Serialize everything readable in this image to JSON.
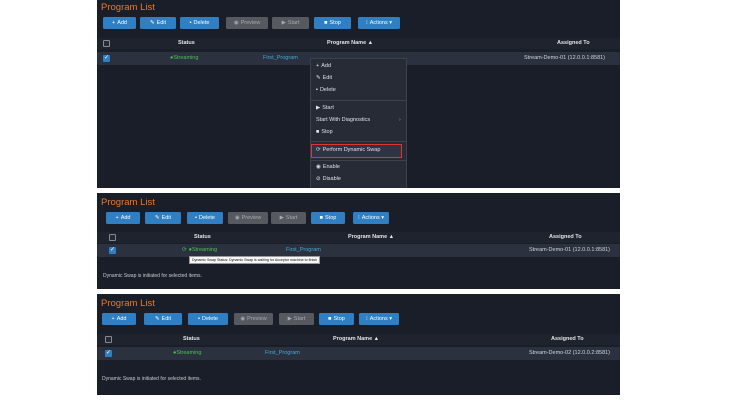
{
  "panels": [
    {
      "title": "Program List",
      "toolbar": {
        "add": "Add",
        "edit": "Edit",
        "delete": "Delete",
        "preview": "Preview",
        "start": "Start",
        "stop": "Stop",
        "actions": "Actions"
      },
      "headers": {
        "status": "Status",
        "program_name": "Program Name",
        "assigned_to": "Assigned To"
      },
      "row": {
        "status": "Streaming",
        "program_name": "First_Program",
        "assigned_to": "Stream-Demo-01 (12.0.0.1:8581)"
      },
      "menu": {
        "add": "Add",
        "edit": "Edit",
        "delete": "Delete",
        "start": "Start",
        "start_diag": "Start With Diagnostics",
        "stop": "Stop",
        "dynamic_swap": "Perform Dynamic Swap",
        "enable": "Enable",
        "disable": "Disable"
      }
    },
    {
      "title": "Program List",
      "toolbar": {
        "add": "Add",
        "edit": "Edit",
        "delete": "Delete",
        "preview": "Preview",
        "start": "Start",
        "stop": "Stop",
        "actions": "Actions"
      },
      "headers": {
        "status": "Status",
        "program_name": "Program Name",
        "assigned_to": "Assigned To"
      },
      "row": {
        "status": "Streaming",
        "program_name": "First_Program",
        "assigned_to": "Stream-Demo-01 (12.0.0.1:8581)"
      },
      "tooltip": "Dynamic Swap Status: Dynamic Swap is waiting for Acceptor machine to finish",
      "message": "Dynamic Swap is initiated for selected items."
    },
    {
      "title": "Program List",
      "toolbar": {
        "add": "Add",
        "edit": "Edit",
        "delete": "Delete",
        "preview": "Preview",
        "start": "Start",
        "stop": "Stop",
        "actions": "Actions"
      },
      "headers": {
        "status": "Status",
        "program_name": "Program Name",
        "assigned_to": "Assigned To"
      },
      "row": {
        "status": "Streaming",
        "program_name": "First_Program",
        "assigned_to": "Stream-Demo-02 (12.0.0.2:8581)"
      },
      "message": "Dynamic Swap is initiated for selected items."
    }
  ],
  "icons": {
    "add": "plus-icon",
    "edit": "edit-icon",
    "delete": "trash-icon",
    "preview": "eye-icon",
    "start": "play-icon",
    "stop": "stop-icon",
    "actions": "menu-icon",
    "status": "status-dot-icon",
    "sort": "sort-up-icon",
    "swap": "refresh-icon",
    "enable": "circle-check-icon",
    "disable": "ban-icon"
  },
  "colors": {
    "title": "#f07820",
    "primary": "#2f7fc2",
    "disabled": "#56595f",
    "status_ok": "#49c24d",
    "link": "#43a8d9",
    "highlight": "#e03434",
    "panel": "#1a1e28",
    "row": "#2c3140"
  }
}
